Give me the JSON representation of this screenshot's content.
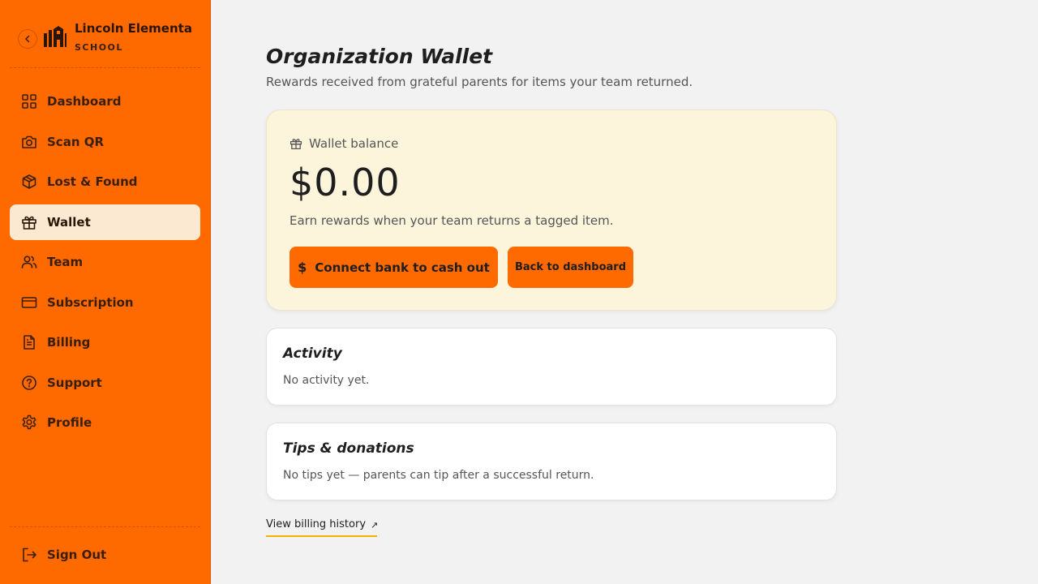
{
  "sidebar": {
    "brand_name": "Lincoln Elementary",
    "brand_subtitle": "SCHOOL",
    "items": [
      {
        "label": "Dashboard",
        "icon": "grid-icon"
      },
      {
        "label": "Scan QR",
        "icon": "camera-icon"
      },
      {
        "label": "Lost & Found",
        "icon": "box-icon"
      },
      {
        "label": "Wallet",
        "icon": "gift-icon",
        "active": true
      },
      {
        "label": "Team",
        "icon": "users-icon"
      },
      {
        "label": "Subscription",
        "icon": "credit-card-icon"
      },
      {
        "label": "Billing",
        "icon": "file-icon"
      },
      {
        "label": "Support",
        "icon": "help-circle-icon"
      },
      {
        "label": "Profile",
        "icon": "gear-icon"
      }
    ],
    "sign_out": "Sign Out",
    "colors": {
      "background": "#ff6a00",
      "active_item": "#fbe9d2"
    }
  },
  "main": {
    "title": "Organization Wallet",
    "subtitle": "Rewards received from grateful parents for items your team returned.",
    "wallet": {
      "label": "Wallet balance",
      "balance": "$0.00",
      "note": "Earn rewards when your team returns a tagged item.",
      "cash_out_button": "Connect bank to cash out",
      "cash_out_icon": "$",
      "back_button": "Back to dashboard",
      "card_color": "#fdf4dc"
    },
    "activity": {
      "title": "Activity",
      "text": "No activity yet."
    },
    "tips": {
      "title": "Tips & donations",
      "text": "No tips yet — parents can tip after a successful return."
    },
    "billing_link": {
      "label": "View billing history",
      "icon": "↗"
    }
  }
}
